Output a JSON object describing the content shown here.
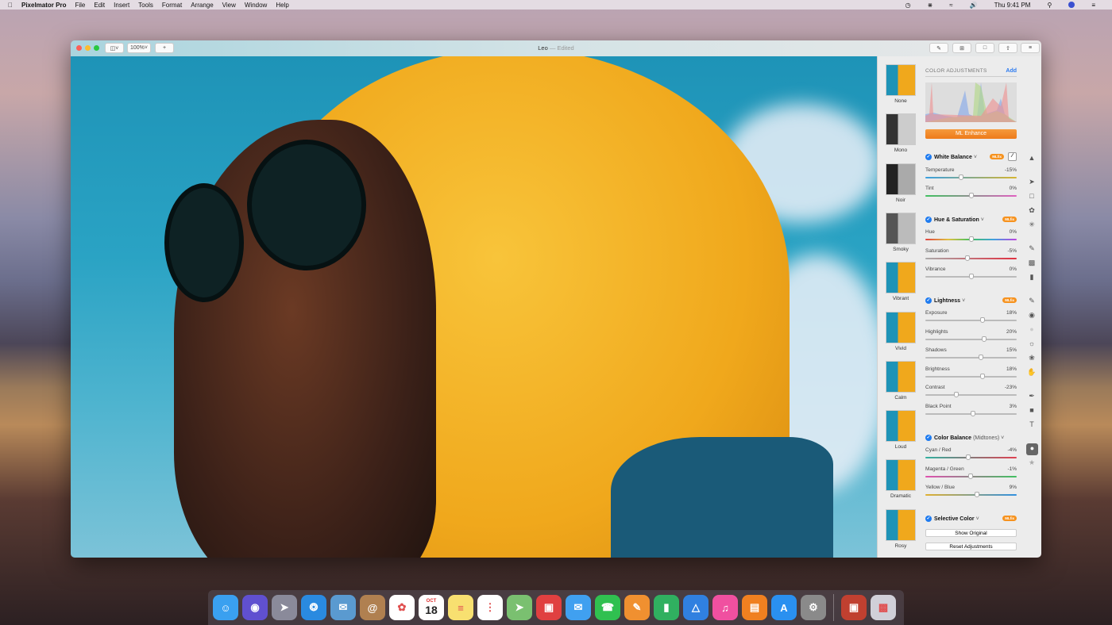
{
  "menubar": {
    "app": "Pixelmator Pro",
    "items": [
      "File",
      "Edit",
      "Insert",
      "Tools",
      "Format",
      "Arrange",
      "View",
      "Window",
      "Help"
    ],
    "clock": "Thu 9:41 PM"
  },
  "window": {
    "title": "Leo",
    "status": "— Edited",
    "zoom": "100%",
    "add": "+"
  },
  "presets": [
    "None",
    "Mono",
    "Noir",
    "Smoky",
    "Vibrant",
    "Vivid",
    "Calm",
    "Loud",
    "Dramatic",
    "Rosy"
  ],
  "panel": {
    "header": "COLOR ADJUSTMENTS",
    "add": "Add",
    "ml_enhance": "ML Enhance",
    "badge": "MLfix",
    "sections": [
      {
        "title": "White Balance",
        "sub": "",
        "sliders": [
          {
            "label": "Temperature",
            "value": "-15%",
            "pos": -15
          },
          {
            "label": "Tint",
            "value": "0%",
            "pos": 0
          }
        ]
      },
      {
        "title": "Hue & Saturation",
        "sub": "",
        "sliders": [
          {
            "label": "Hue",
            "value": "0%",
            "pos": 0
          },
          {
            "label": "Saturation",
            "value": "-5%",
            "pos": -5
          },
          {
            "label": "Vibrance",
            "value": "0%",
            "pos": 0
          }
        ]
      },
      {
        "title": "Lightness",
        "sub": "",
        "sliders": [
          {
            "label": "Exposure",
            "value": "18%",
            "pos": 18
          },
          {
            "label": "Highlights",
            "value": "20%",
            "pos": 20
          },
          {
            "label": "Shadows",
            "value": "15%",
            "pos": 15
          },
          {
            "label": "Brightness",
            "value": "18%",
            "pos": 18
          },
          {
            "label": "Contrast",
            "value": "-23%",
            "pos": -23
          },
          {
            "label": "Black Point",
            "value": "3%",
            "pos": 3
          }
        ]
      },
      {
        "title": "Color Balance",
        "sub": "(Midtones)",
        "sliders": [
          {
            "label": "Cyan / Red",
            "value": "-4%",
            "pos": -4
          },
          {
            "label": "Magenta / Green",
            "value": "-1%",
            "pos": -1
          },
          {
            "label": "Yellow / Blue",
            "value": "9%",
            "pos": 9
          }
        ]
      },
      {
        "title": "Selective Color",
        "sub": "",
        "sliders": []
      }
    ],
    "show_original": "Show Original",
    "reset": "Reset Adjustments"
  },
  "dock": {
    "calendar_month": "OCT",
    "calendar_day": "18"
  }
}
